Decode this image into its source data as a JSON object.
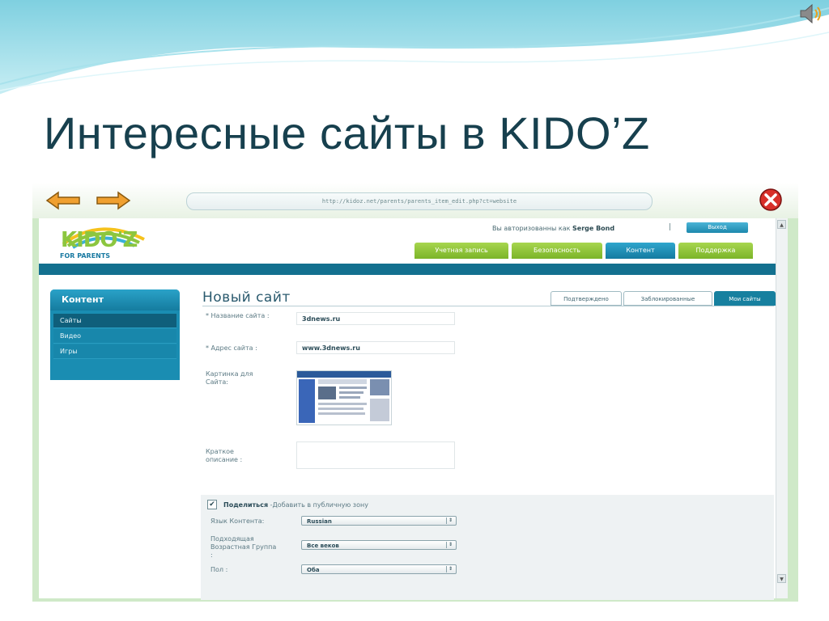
{
  "slide": {
    "title": "Интересные сайты в KIDO’Z"
  },
  "browser": {
    "url": "http://kidoz.net/parents/parents_item_edit.php?ct=website"
  },
  "header": {
    "logo_text": "KIDO'Z",
    "logo_subtitle": "FOR PARENTS",
    "auth_prefix": "Вы авторизованны как",
    "auth_user": "Serge Bond",
    "separator": "|",
    "logout_label": "Выход",
    "nav": [
      {
        "label": "Учетная запись",
        "color": "#8cc63f"
      },
      {
        "label": "Безопасность",
        "color": "#8cc63f"
      },
      {
        "label": "Контент",
        "color": "#147aa0",
        "active": true
      },
      {
        "label": "Поддержка",
        "color": "#8cc63f"
      }
    ]
  },
  "sidebar": {
    "heading": "Контент",
    "items": [
      {
        "label": "Сайты",
        "active": true
      },
      {
        "label": "Видео"
      },
      {
        "label": "Игры"
      }
    ]
  },
  "main": {
    "page_title": "Новый сайт",
    "tabs": [
      {
        "label": "Подтверждено"
      },
      {
        "label": "Заблокированные"
      },
      {
        "label": "Мои сайты",
        "active": true
      }
    ],
    "form": {
      "site_name_label": "* Название сайта :",
      "site_name_value": "3dnews.ru",
      "site_address_label": "* Адрес сайта :",
      "site_address_value": "www.3dnews.ru",
      "picture_label": "Картинка для Сайта:",
      "description_label": "Краткое описание :",
      "description_value": ""
    },
    "share": {
      "checked": true,
      "share_label": "Поделиться",
      "share_hint": "-Добавить в публичную зону",
      "language_label": "Язык Контента:",
      "language_value": "Russian",
      "age_label": "Подходящая Возрастная Группа :",
      "age_value": "Все веков",
      "gender_label": "Пол :",
      "gender_value": "Оба"
    }
  },
  "colors": {
    "slide_title": "#17404e",
    "accent_blue": "#13708f",
    "accent_green": "#8cc63f"
  }
}
